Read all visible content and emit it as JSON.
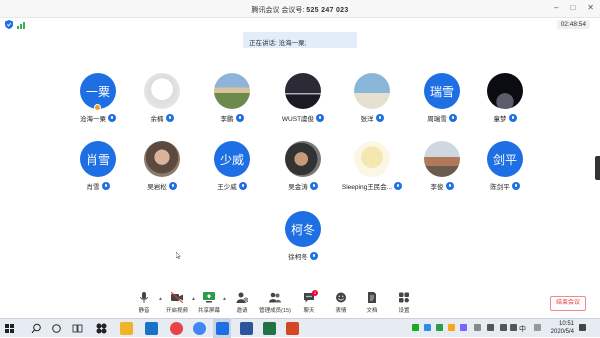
{
  "titlebar": {
    "title_prefix": "腾讯会议 会议号:",
    "meeting_id": "525 247 023"
  },
  "status": {
    "timer": "02:48:54"
  },
  "speaking_banner": "正在讲话: 沧海一粟;",
  "participants": [
    {
      "name": "沧海一粟",
      "avatar_text": "一粟",
      "avatar_type": "text",
      "speaking": true
    },
    {
      "name": "余楠",
      "avatar_text": "",
      "avatar_type": "photo",
      "photo": "cartoon"
    },
    {
      "name": "李鹏",
      "avatar_text": "",
      "avatar_type": "photo",
      "photo": "landscape"
    },
    {
      "name": "WUST虞俊",
      "avatar_text": "",
      "avatar_type": "photo",
      "photo": "night-city"
    },
    {
      "name": "张洋",
      "avatar_text": "",
      "avatar_type": "photo",
      "photo": "beach"
    },
    {
      "name": "周瑞雪",
      "avatar_text": "瑞雪",
      "avatar_type": "text"
    },
    {
      "name": "童梦",
      "avatar_text": "",
      "avatar_type": "photo",
      "photo": "space"
    },
    {
      "name": "肖雪",
      "avatar_text": "肖雪",
      "avatar_type": "text"
    },
    {
      "name": "吴岩松",
      "avatar_text": "",
      "avatar_type": "photo",
      "photo": "person"
    },
    {
      "name": "王少威",
      "avatar_text": "少威",
      "avatar_type": "text"
    },
    {
      "name": "吴金涛",
      "avatar_text": "",
      "avatar_type": "photo",
      "photo": "person-dark"
    },
    {
      "name": "Sleeping王民会...",
      "avatar_text": "",
      "avatar_type": "photo",
      "photo": "cartoon-yellow"
    },
    {
      "name": "李俊",
      "avatar_text": "",
      "avatar_type": "photo",
      "photo": "group"
    },
    {
      "name": "陈剑平",
      "avatar_text": "剑平",
      "avatar_type": "text"
    },
    {
      "name": "徐柯冬",
      "avatar_text": "柯冬",
      "avatar_type": "text"
    }
  ],
  "toolbar": {
    "mute": "静音",
    "video": "开启视频",
    "share": "共享屏幕",
    "invite": "邀请",
    "members": "管理成员(15)",
    "chat": "聊天",
    "chat_badge": "1",
    "reactions": "表情",
    "docs": "文档",
    "settings": "设置",
    "end_meeting": "结束会议"
  },
  "taskbar": {
    "ime": "中",
    "time": "10:51",
    "date": "2020/5/4"
  },
  "colors": {
    "accent": "#1f6fe4",
    "end_button": "#e03b3b",
    "signal": "#3bb24b"
  }
}
